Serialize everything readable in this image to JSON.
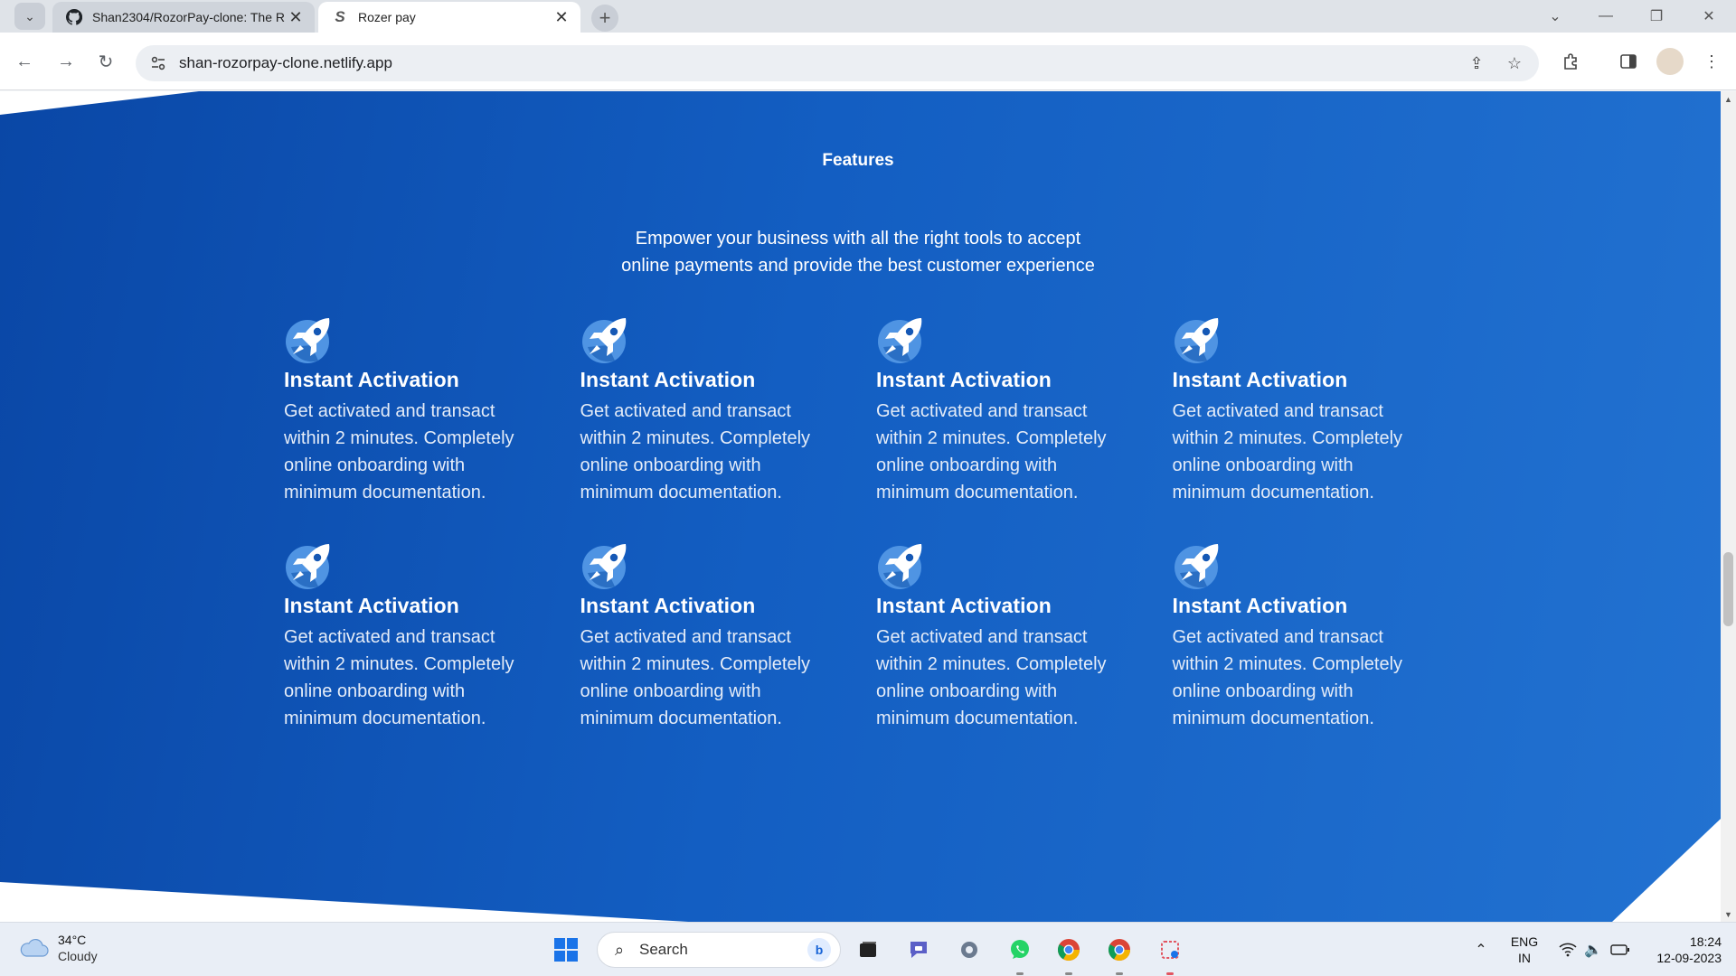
{
  "browser": {
    "tabs": [
      {
        "title": "Shan2304/RozorPay-clone: The R",
        "active": false,
        "icon": "github-icon"
      },
      {
        "title": "Rozer pay",
        "active": true,
        "icon": "s-favicon-icon"
      }
    ],
    "url": "shan-rozorpay-clone.netlify.app"
  },
  "page": {
    "section_title": "Features",
    "subtitle_line1": "Empower your business with all the right tools to accept",
    "subtitle_line2": "online payments and provide the best customer experience",
    "features": [
      {
        "title": "Instant Activation",
        "text": "Get activated and transact within 2 minutes. Completely online onboarding with minimum documentation.",
        "icon": "rocket-icon"
      },
      {
        "title": "Instant Activation",
        "text": "Get activated and transact within 2 minutes. Completely online onboarding with minimum documentation.",
        "icon": "rocket-icon"
      },
      {
        "title": "Instant Activation",
        "text": "Get activated and transact within 2 minutes. Completely online onboarding with minimum documentation.",
        "icon": "rocket-icon"
      },
      {
        "title": "Instant Activation",
        "text": "Get activated and transact within 2 minutes. Completely online onboarding with minimum documentation.",
        "icon": "rocket-icon"
      },
      {
        "title": "Instant Activation",
        "text": "Get activated and transact within 2 minutes. Completely online onboarding with minimum documentation.",
        "icon": "rocket-icon"
      },
      {
        "title": "Instant Activation",
        "text": "Get activated and transact within 2 minutes. Completely online onboarding with minimum documentation.",
        "icon": "rocket-icon"
      },
      {
        "title": "Instant Activation",
        "text": "Get activated and transact within 2 minutes. Completely online onboarding with minimum documentation.",
        "icon": "rocket-icon"
      },
      {
        "title": "Instant Activation",
        "text": "Get activated and transact within 2 minutes. Completely online onboarding with minimum documentation.",
        "icon": "rocket-icon"
      }
    ],
    "colors": {
      "band_start": "#0a47a6",
      "band_end": "#2272d1",
      "text": "#ffffff"
    }
  },
  "taskbar": {
    "weather": {
      "temp": "34°C",
      "condition": "Cloudy"
    },
    "search_label": "Search",
    "language": {
      "line1": "ENG",
      "line2": "IN"
    },
    "clock": {
      "time": "18:24",
      "date": "12-09-2023"
    }
  }
}
